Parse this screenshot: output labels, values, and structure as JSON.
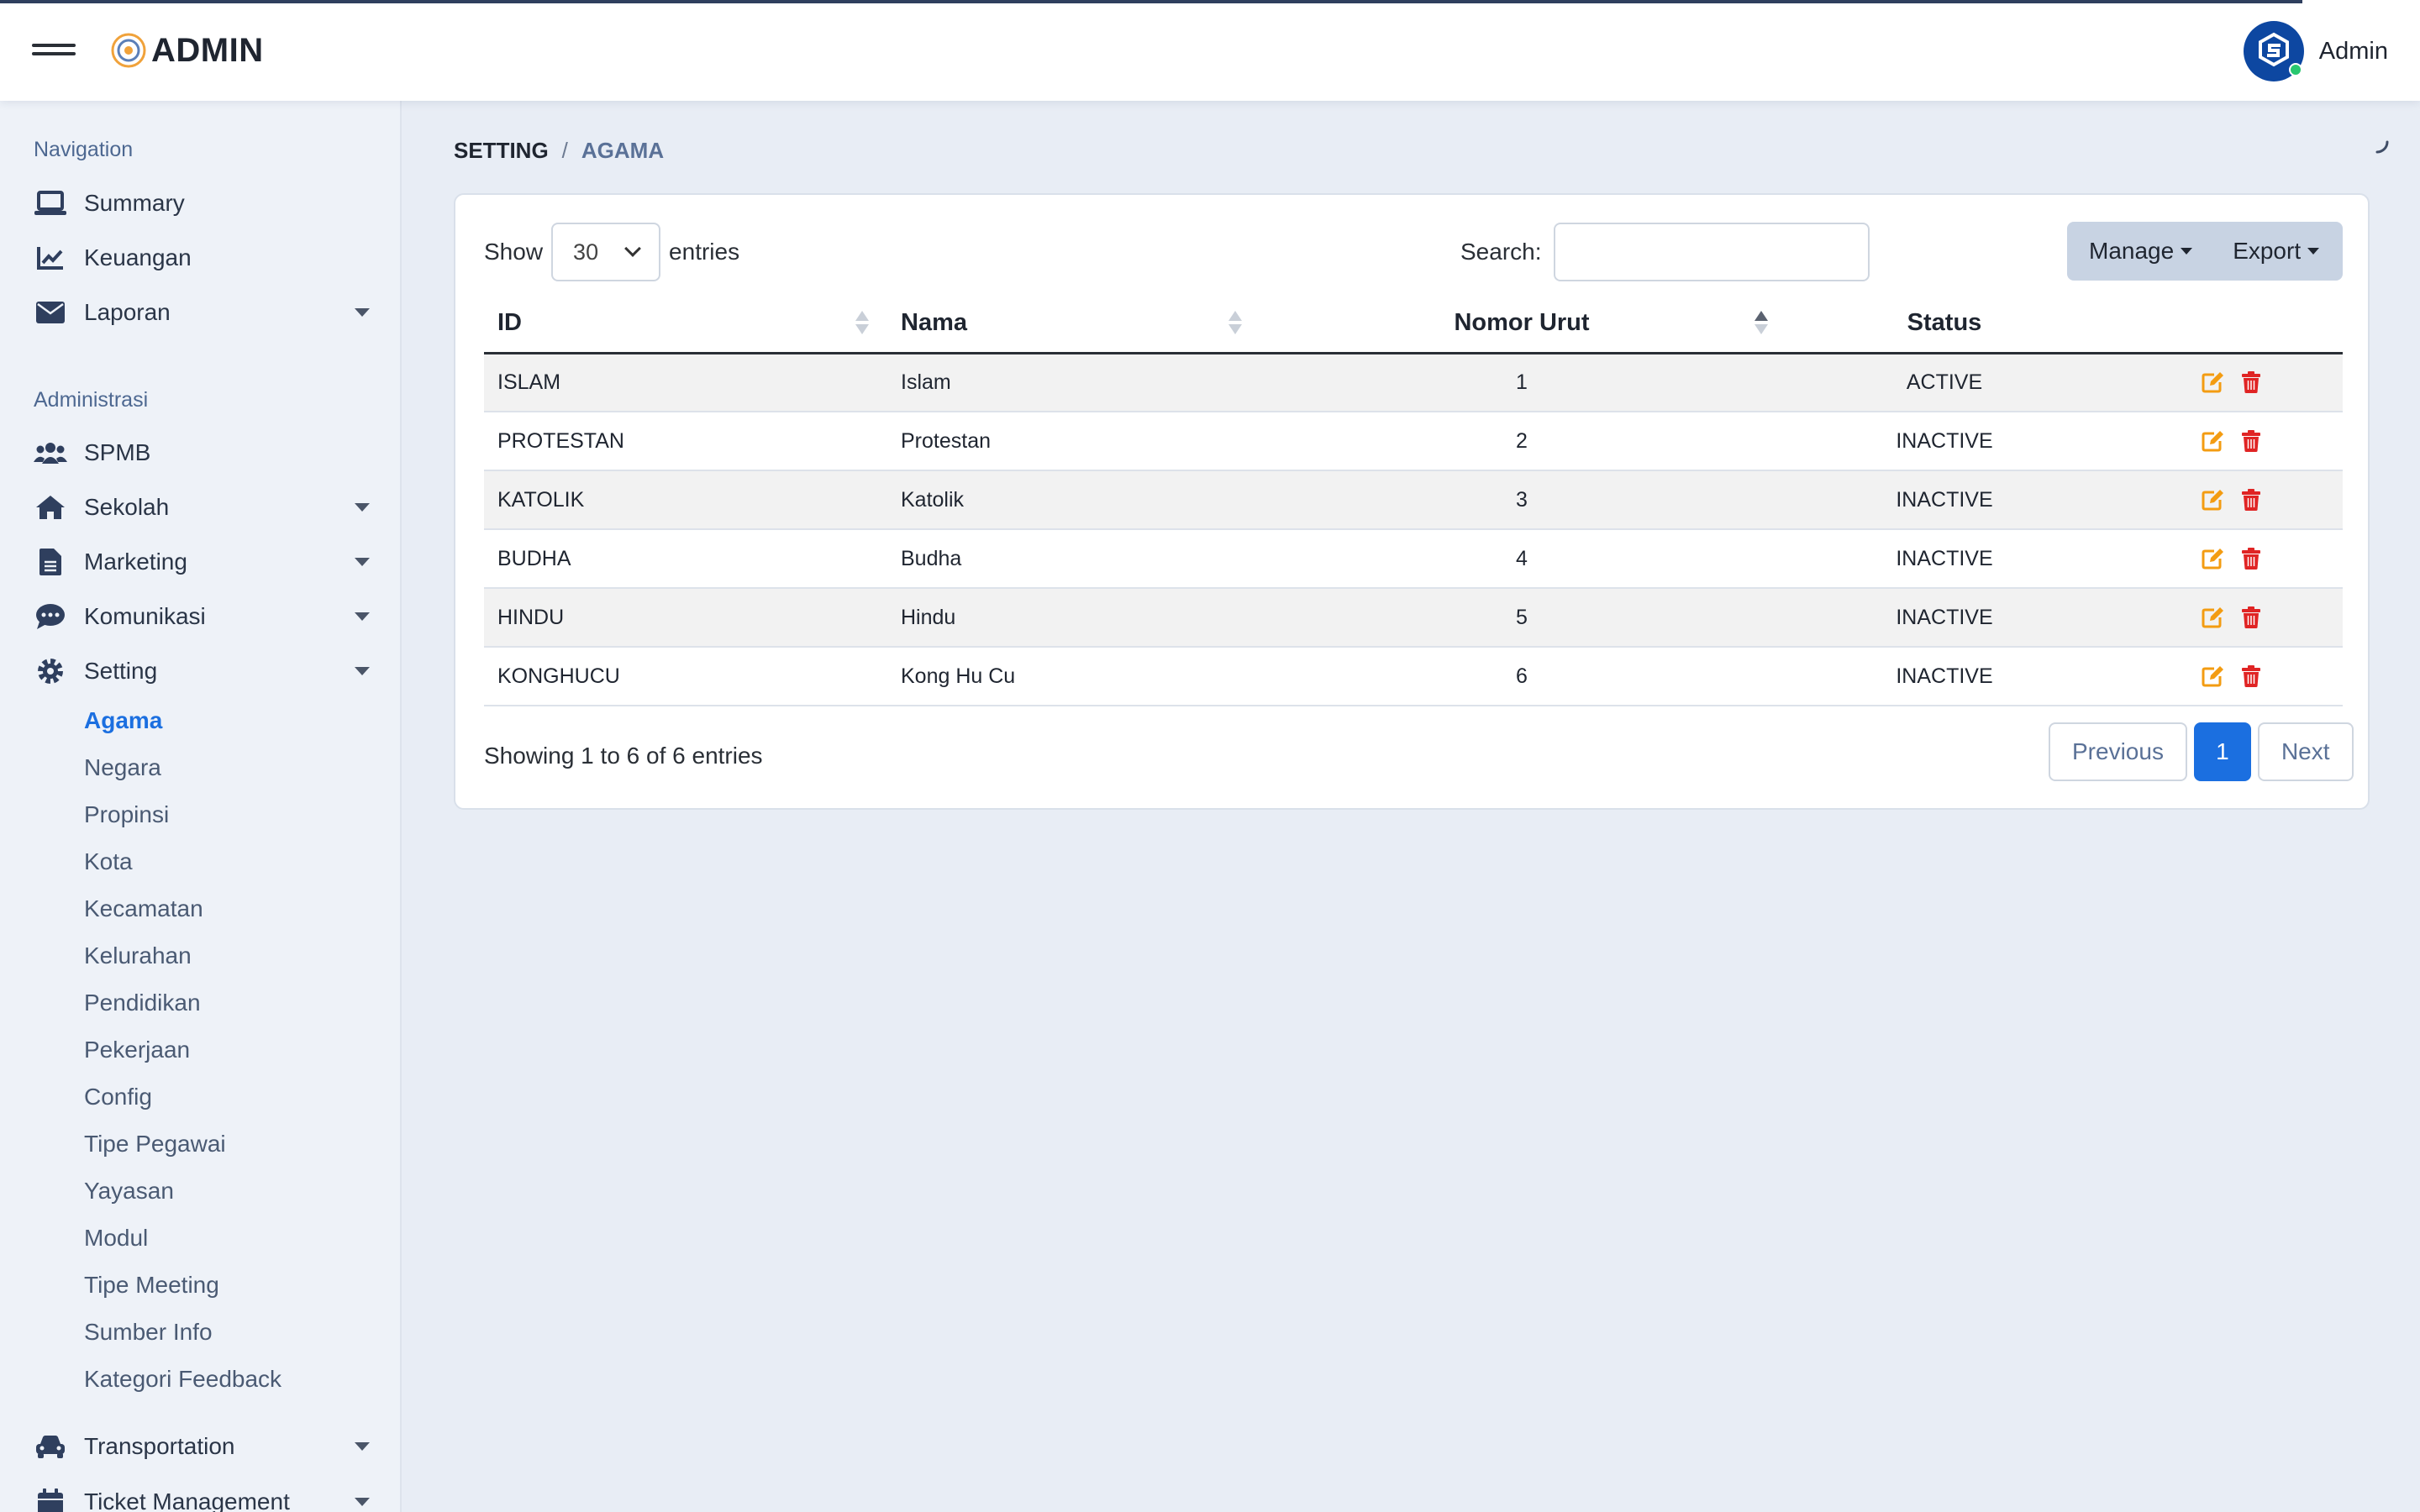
{
  "topbar": {
    "brand": "ADMIN",
    "user_name": "Admin"
  },
  "sidebar": {
    "section_navigation": "Navigation",
    "nav": [
      {
        "label": "Summary",
        "icon": "laptop-icon"
      },
      {
        "label": "Keuangan",
        "icon": "chart-line-icon"
      },
      {
        "label": "Laporan",
        "icon": "envelope-icon"
      }
    ],
    "section_admin": "Administrasi",
    "admin": [
      {
        "label": "SPMB",
        "icon": "users-icon"
      },
      {
        "label": "Sekolah",
        "icon": "home-icon"
      },
      {
        "label": "Marketing",
        "icon": "file-icon"
      },
      {
        "label": "Komunikasi",
        "icon": "comment-icon"
      },
      {
        "label": "Setting",
        "icon": "gear-icon"
      }
    ],
    "setting_sub": [
      "Agama",
      "Negara",
      "Propinsi",
      "Kota",
      "Kecamatan",
      "Kelurahan",
      "Pendidikan",
      "Pekerjaan",
      "Config",
      "Tipe Pegawai",
      "Yayasan",
      "Modul",
      "Tipe Meeting",
      "Sumber Info",
      "Kategori Feedback"
    ],
    "bottom": [
      {
        "label": "Transportation",
        "icon": "car-icon"
      },
      {
        "label": "Ticket Management",
        "icon": "calendar-icon"
      }
    ]
  },
  "breadcrumb": {
    "parent": "SETTING",
    "separator": "/",
    "current": "AGAMA"
  },
  "controls": {
    "show_label": "Show",
    "entries_value": "30",
    "entries_label": "entries",
    "search_label": "Search:",
    "search_value": "",
    "manage_label": "Manage",
    "export_label": "Export"
  },
  "table": {
    "headers": [
      "ID",
      "Nama",
      "Nomor Urut",
      "Status"
    ],
    "rows": [
      {
        "id": "ISLAM",
        "nama": "Islam",
        "urut": "1",
        "status": "ACTIVE"
      },
      {
        "id": "PROTESTAN",
        "nama": "Protestan",
        "urut": "2",
        "status": "INACTIVE"
      },
      {
        "id": "KATOLIK",
        "nama": "Katolik",
        "urut": "3",
        "status": "INACTIVE"
      },
      {
        "id": "BUDHA",
        "nama": "Budha",
        "urut": "4",
        "status": "INACTIVE"
      },
      {
        "id": "HINDU",
        "nama": "Hindu",
        "urut": "5",
        "status": "INACTIVE"
      },
      {
        "id": "KONGHUCU",
        "nama": "Kong Hu Cu",
        "urut": "6",
        "status": "INACTIVE"
      }
    ]
  },
  "footer": {
    "info": "Showing 1 to 6 of 6 entries",
    "previous": "Previous",
    "page": "1",
    "next": "Next"
  },
  "colors": {
    "accent": "#1b6fe0",
    "edit": "#f39c12",
    "delete": "#e02424"
  }
}
